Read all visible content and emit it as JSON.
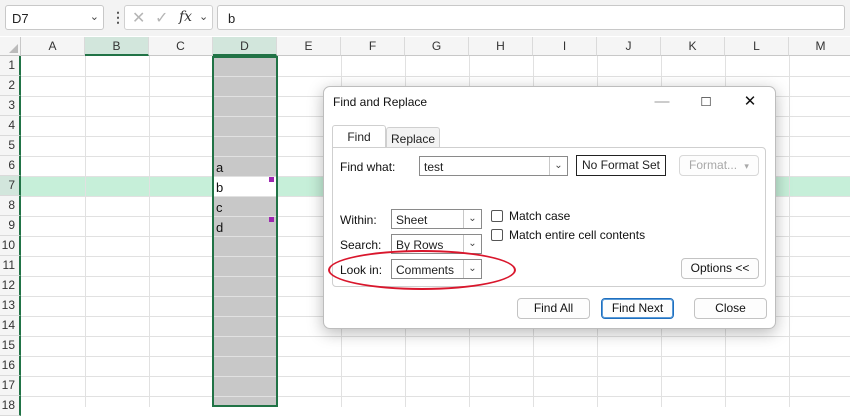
{
  "formula_bar": {
    "name_box": "D7",
    "fx": "fx",
    "content": "b"
  },
  "columns": [
    "A",
    "B",
    "C",
    "D",
    "E",
    "F",
    "G",
    "H",
    "I",
    "J",
    "K",
    "L",
    "M"
  ],
  "rows": [
    "1",
    "2",
    "3",
    "4",
    "5",
    "6",
    "7",
    "8",
    "9",
    "10",
    "11",
    "12",
    "13",
    "14",
    "15",
    "16",
    "17",
    "18"
  ],
  "cells": {
    "D6": "a",
    "D7": "b",
    "D8": "c",
    "D9": "d"
  },
  "dialog": {
    "title": "Find and Replace",
    "tabs": [
      "Find",
      "Replace"
    ],
    "find_what_label": "Find what:",
    "find_what_value": "test",
    "no_format_set": "No Format Set",
    "format_button": "Format...",
    "within_label": "Within:",
    "within_value": "Sheet",
    "search_label": "Search:",
    "search_value": "By Rows",
    "look_in_label": "Look in:",
    "look_in_value": "Comments",
    "match_case": "Match case",
    "match_entire": "Match entire cell contents",
    "options_button": "Options <<",
    "find_all": "Find All",
    "find_next": "Find Next",
    "close": "Close"
  },
  "colors": {
    "accent": "#217346",
    "selected_column_fill": "#c8c8c8",
    "row_highlight": "#c6efd9",
    "annotation": "#d9162c"
  }
}
